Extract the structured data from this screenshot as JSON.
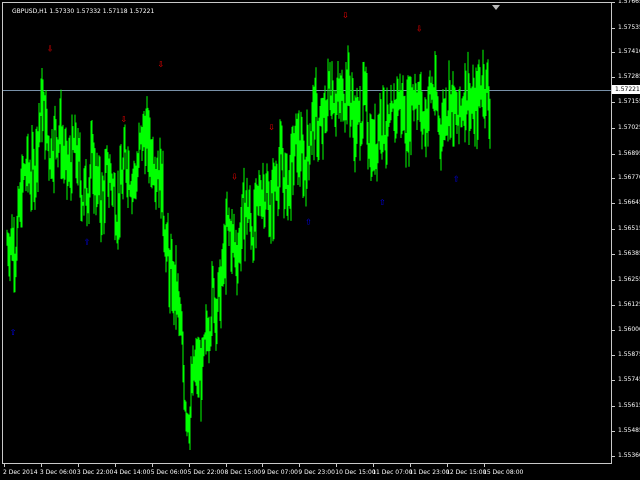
{
  "chart": {
    "symbol_label": "GBPUSD,H1  1.57330 1.57332 1.57118 1.57221",
    "current_price": "1.57221",
    "price_min": 1.5533,
    "price_max": 1.5766,
    "current_price_value": 1.57221,
    "colors": {
      "background": "#000000",
      "candle": "#00ff00",
      "grid_line": "#c8c8c8",
      "bid_line": "#7890a8",
      "up_arrow": "#0000ff",
      "down_arrow": "#ff0000"
    }
  },
  "price_axis": {
    "labels": [
      "1.57665",
      "1.57535",
      "1.57410",
      "1.57285",
      "1.57155",
      "1.57025",
      "1.56895",
      "1.56770",
      "1.56645",
      "1.56515",
      "1.56385",
      "1.56255",
      "1.56125",
      "1.56000",
      "1.55875",
      "1.55745",
      "1.55615",
      "1.55485",
      "1.55360"
    ]
  },
  "time_axis": {
    "labels": [
      "2 Dec 2014",
      "3 Dec 06:00",
      "3 Dec 22:00",
      "4 Dec 14:00",
      "5 Dec 06:00",
      "5 Dec 22:00",
      "8 Dec 15:00",
      "9 Dec 07:00",
      "9 Dec 23:00",
      "10 Dec 15:00",
      "11 Dec 07:00",
      "11 Dec 23:00",
      "12 Dec 15:00",
      "15 Dec 08:00"
    ]
  },
  "fractal_icons": {
    "up": "arrow-up-icon",
    "down": "arrow-down-icon"
  },
  "chart_data": {
    "type": "line",
    "x": [
      "2 Dec 2014",
      "3 Dec 06:00",
      "3 Dec 22:00",
      "4 Dec 14:00",
      "5 Dec 06:00",
      "5 Dec 22:00",
      "8 Dec 15:00",
      "9 Dec 07:00",
      "9 Dec 23:00",
      "10 Dec 15:00",
      "11 Dec 07:00",
      "11 Dec 23:00",
      "12 Dec 15:00",
      "15 Dec 08:00"
    ],
    "series": [
      {
        "values": [
          1.5634,
          1.5708,
          1.568,
          1.5672,
          1.57,
          1.556,
          1.5643,
          1.5668,
          1.569,
          1.5725,
          1.57,
          1.5718,
          1.5712,
          1.5722
        ]
      }
    ],
    "ylim": [
      1.5533,
      1.5766
    ]
  }
}
